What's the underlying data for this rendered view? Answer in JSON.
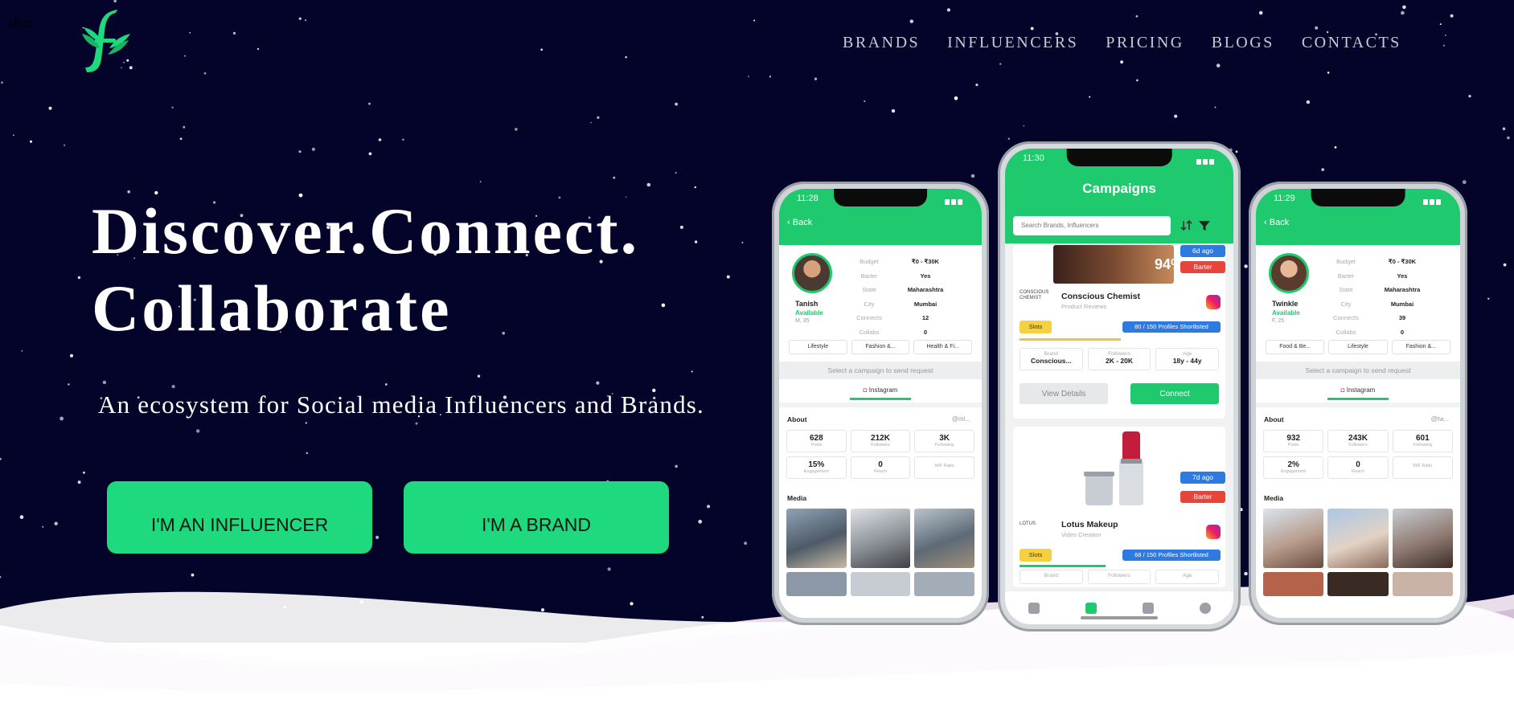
{
  "alt_text": "aftar",
  "nav": {
    "items": [
      "BRANDS",
      "INFLUENCERS",
      "PRICING",
      "BLOGS",
      "CONTACTS"
    ]
  },
  "hero": {
    "headline_line1": "Discover.Connect.",
    "headline_line2": "Collaborate",
    "subtitle": "An ecosystem for Social media Influencers and Brands.",
    "cta_influencer": "I'M AN INFLUENCER",
    "cta_brand": "I'M A BRAND"
  },
  "phone_left": {
    "time": "11:28",
    "back": "Back",
    "name": "Tanish",
    "availability": "Available",
    "meta": "M, 35",
    "details": [
      {
        "key": "Budget",
        "value": "₹0 - ₹30K"
      },
      {
        "key": "Barter",
        "value": "Yes"
      },
      {
        "key": "State",
        "value": "Maharashtra"
      },
      {
        "key": "City",
        "value": "Mumbai"
      },
      {
        "key": "Connects",
        "value": "12"
      },
      {
        "key": "Collabs",
        "value": "0"
      }
    ],
    "chips": [
      "Lifestyle",
      "Fashion &...",
      "Health & Fi..."
    ],
    "select_prompt": "Select a campaign to send request",
    "platform_tab": "Instagram",
    "about_label": "About",
    "handle": "@mi...",
    "stats": [
      {
        "value": "628",
        "label": "Posts"
      },
      {
        "value": "212K",
        "label": "Followers"
      },
      {
        "value": "3K",
        "label": "Following"
      },
      {
        "value": "15%",
        "label": "Engagement"
      },
      {
        "value": "0",
        "label": "Reach"
      },
      {
        "value": "",
        "label": "M/F Ratio"
      }
    ],
    "media_label": "Media"
  },
  "phone_center": {
    "time": "11:30",
    "title": "Campaigns",
    "search_placeholder": "Search Brands, Influencers",
    "campaigns": [
      {
        "ago": "6d ago",
        "barter": "Barter",
        "promo": "94%",
        "brand_logo": "CONSCIOUS CHEMIST",
        "brand": "Conscious Chemist",
        "type": "Product Reviews",
        "slots": "Slots",
        "shortlisted": "80 / 150 Profiles Shortlisted",
        "shortlist_fraction": 0.53,
        "brand_label": "Brand",
        "brand_value": "Conscious...",
        "followers_label": "Followers",
        "followers_value": "2K - 20K",
        "age_label": "Age",
        "age_value": "18y - 44y",
        "view": "View Details",
        "connect": "Connect"
      },
      {
        "ago": "7d ago",
        "barter": "Barter",
        "brand_logo": "LOTUS",
        "brand": "Lotus Makeup",
        "type": "Video Creation",
        "slots": "Slots",
        "shortlisted": "68 / 150 Profiles Shortlisted",
        "shortlist_fraction": 0.45,
        "brand_label": "Brand",
        "followers_label": "Followers",
        "age_label": "Age"
      }
    ]
  },
  "phone_right": {
    "time": "11:29",
    "back": "Back",
    "name": "Twinkle",
    "availability": "Available",
    "meta": "F, 25",
    "details": [
      {
        "key": "Budget",
        "value": "₹0 - ₹30K"
      },
      {
        "key": "Barter",
        "value": "Yes"
      },
      {
        "key": "State",
        "value": "Maharashtra"
      },
      {
        "key": "City",
        "value": "Mumbai"
      },
      {
        "key": "Connects",
        "value": "39"
      },
      {
        "key": "Collabs",
        "value": "0"
      }
    ],
    "chips": [
      "Food & Be...",
      "Lifestyle",
      "Fashion &..."
    ],
    "select_prompt": "Select a campaign to send request",
    "platform_tab": "Instagram",
    "about_label": "About",
    "handle": "@tw...",
    "stats": [
      {
        "value": "932",
        "label": "Posts"
      },
      {
        "value": "243K",
        "label": "Followers"
      },
      {
        "value": "601",
        "label": "Following"
      },
      {
        "value": "2%",
        "label": "Engagement"
      },
      {
        "value": "0",
        "label": "Reach"
      },
      {
        "value": "",
        "label": "M/F Ratio"
      }
    ],
    "media_label": "Media"
  },
  "colors": {
    "sky": "#04042a",
    "accent_green": "#1ed97d",
    "app_green": "#1fc96e",
    "badge_blue": "#2d7be0",
    "badge_red": "#e8443a"
  }
}
